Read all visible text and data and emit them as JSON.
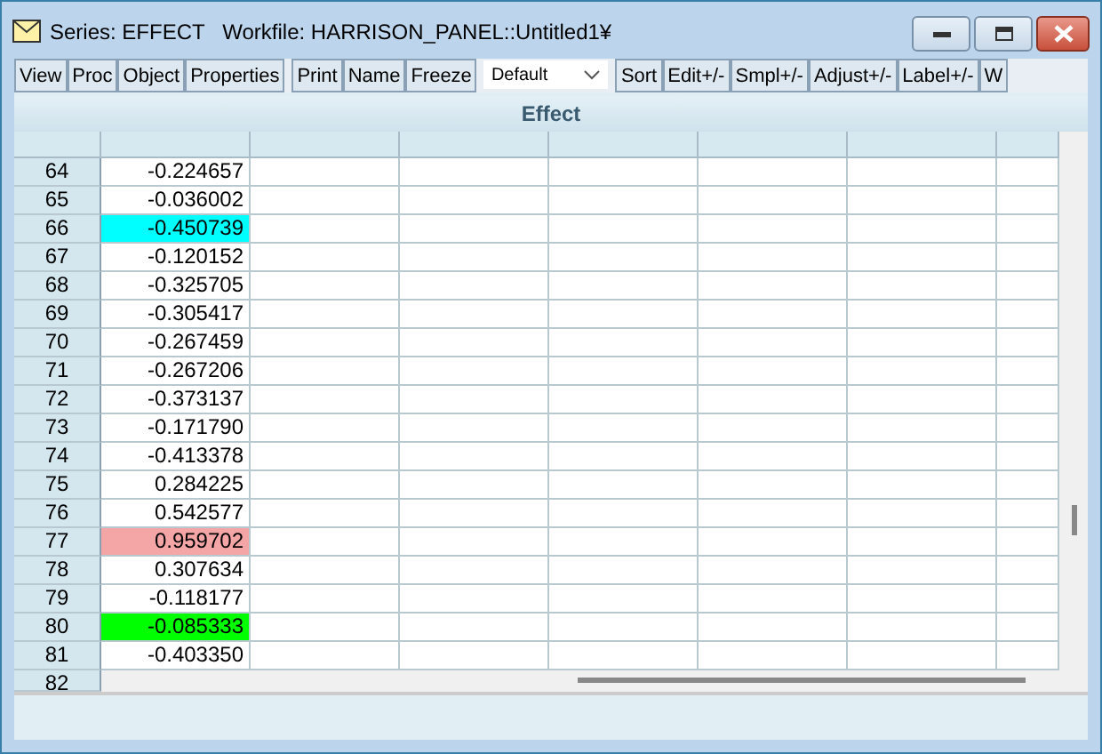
{
  "window": {
    "title": "Series: EFFECT   Workfile: HARRISON_PANEL::Untitled1¥"
  },
  "toolbar": {
    "button_groups": [
      [
        "View",
        "Proc",
        "Object",
        "Properties"
      ],
      [
        "Print",
        "Name",
        "Freeze"
      ]
    ],
    "dropdown": {
      "value": "Default"
    },
    "buttons_after": [
      "Sort",
      "Edit+/-",
      "Smpl+/-",
      "Adjust+/-",
      "Label+/-",
      "W"
    ]
  },
  "table": {
    "title": "Effect",
    "rows": [
      {
        "obs": "64",
        "value": "-0.224657"
      },
      {
        "obs": "65",
        "value": "-0.036002"
      },
      {
        "obs": "66",
        "value": "-0.450739",
        "color": "#00ffff"
      },
      {
        "obs": "67",
        "value": "-0.120152"
      },
      {
        "obs": "68",
        "value": "-0.325705"
      },
      {
        "obs": "69",
        "value": "-0.305417"
      },
      {
        "obs": "70",
        "value": "-0.267459"
      },
      {
        "obs": "71",
        "value": "-0.267206"
      },
      {
        "obs": "72",
        "value": "-0.373137"
      },
      {
        "obs": "73",
        "value": "-0.171790"
      },
      {
        "obs": "74",
        "value": "-0.413378"
      },
      {
        "obs": "75",
        "value": "0.284225"
      },
      {
        "obs": "76",
        "value": "0.542577"
      },
      {
        "obs": "77",
        "value": "0.959702",
        "color": "#f4a6a6"
      },
      {
        "obs": "78",
        "value": "0.307634"
      },
      {
        "obs": "79",
        "value": "-0.118177"
      },
      {
        "obs": "80",
        "value": "-0.085333",
        "color": "#00ff00"
      },
      {
        "obs": "81",
        "value": "-0.403350"
      },
      {
        "obs": "82"
      }
    ]
  }
}
